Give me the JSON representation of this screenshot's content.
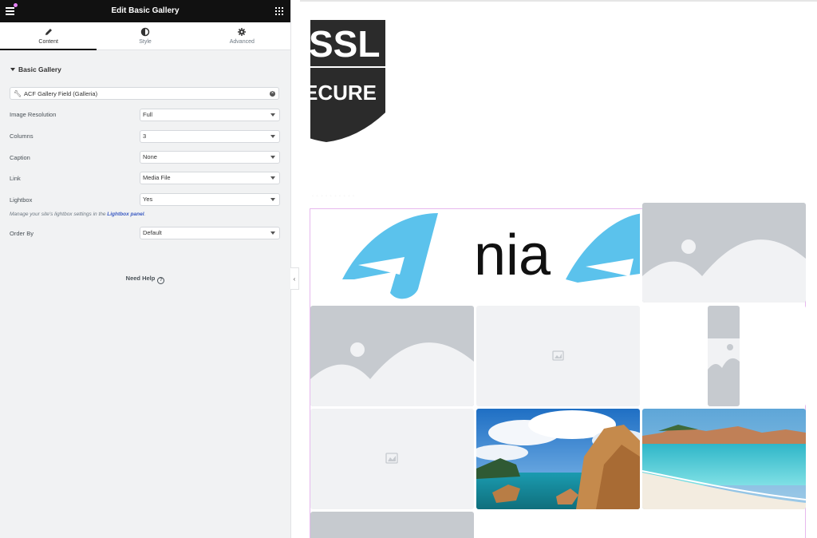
{
  "panel": {
    "title": "Edit Basic Gallery",
    "tabs": [
      {
        "label": "Content",
        "icon": "pencil-icon",
        "active": true
      },
      {
        "label": "Style",
        "icon": "half-circle-icon",
        "active": false
      },
      {
        "label": "Advanced",
        "icon": "gear-icon",
        "active": false
      }
    ],
    "section_title": "Basic Gallery",
    "dynamic_field": "ACF Gallery Field (Galleria)",
    "controls": [
      {
        "label": "Image Resolution",
        "value": "Full"
      },
      {
        "label": "Columns",
        "value": "3"
      },
      {
        "label": "Caption",
        "value": "None"
      },
      {
        "label": "Link",
        "value": "Media File"
      },
      {
        "label": "Lightbox",
        "value": "Yes"
      },
      {
        "label": "Order By",
        "value": "Default"
      }
    ],
    "note_prefix": "Manage your site's lightbox settings in the ",
    "note_link": "Lightbox panel",
    "note_suffix": ".",
    "need_help": "Need Help",
    "collapse_glyph": "‹"
  },
  "preview": {
    "ssl_logo_line1": "SSL",
    "ssl_logo_line2": "ECURE",
    "logo_text": "nia",
    "blurred_caption": "· · · · · · · · · ·"
  },
  "colors": {
    "topbar": "#111111",
    "panel_bg": "#f1f2f3",
    "accent_link": "#3a5ac2",
    "notification_dot": "#e683f5",
    "logo_blue": "#5bc2ec"
  }
}
